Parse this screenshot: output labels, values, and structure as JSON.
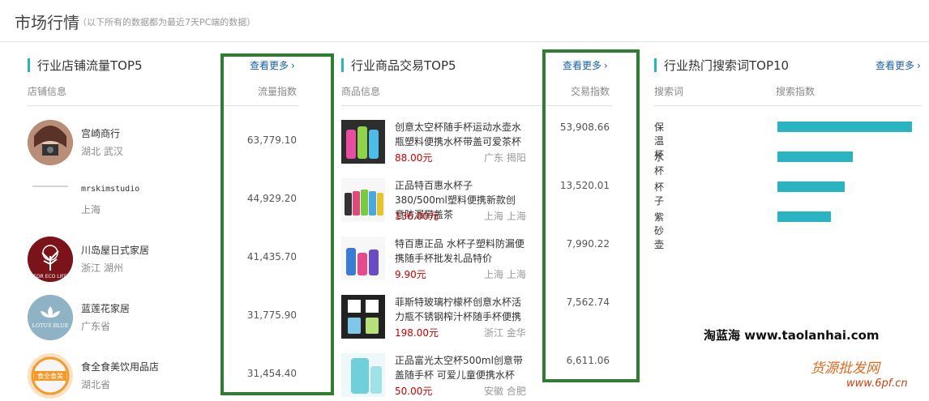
{
  "header": {
    "title": "市场行情",
    "subtitle": "（以下所有的数据都为最近7天PC端的数据）"
  },
  "shops": {
    "title": "行业店铺流量TOP5",
    "more": "查看更多",
    "col_info": "店铺信息",
    "col_value": "流量指数",
    "items": [
      {
        "name": "宫崎商行",
        "location": "湖北 武汉",
        "value": "63,779.10",
        "avatar_text": ""
      },
      {
        "name": "mrskimstudio",
        "location": "上海",
        "value": "44,929.20",
        "avatar_text": ""
      },
      {
        "name": "川岛屋日式家居",
        "location": "浙江 湖州",
        "value": "41,435.70",
        "avatar_text": "FOR ECO LIFE"
      },
      {
        "name": "蓝莲花家居",
        "location": "广东省",
        "value": "31,775.90",
        "avatar_text": "LOTUS BLUE"
      },
      {
        "name": "食全食美饮用品店",
        "location": "湖北省",
        "value": "31,454.40",
        "avatar_text": "食全食美"
      }
    ]
  },
  "products": {
    "title": "行业商品交易TOP5",
    "more": "查看更多",
    "col_info": "商品信息",
    "col_value": "交易指数",
    "items": [
      {
        "name": "创意太空杯随手杯运动水壶水瓶塑料便携水杯带盖可爱茶杯",
        "price": "88.00元",
        "location": "广东 揭阳",
        "value": "53,908.66"
      },
      {
        "name": "正品特百惠水杯子380/500ml塑料便携新款创意防漏带盖茶",
        "price": "136.00元",
        "location": "上海 上海",
        "value": "13,520.01"
      },
      {
        "name": "特百惠正品 水杯子塑料防漏便携随手杯批发礼品特价",
        "price": "9.90元",
        "location": "上海 上海",
        "value": "7,990.22"
      },
      {
        "name": "菲斯特玻璃柠檬杯创意水杯活力瓶不锈钢榨汁杯随手杯便携",
        "price": "198.00元",
        "location": "浙江 金华",
        "value": "7,562.74"
      },
      {
        "name": "正品富光太空杯500ml创意带盖随手杯 可爱儿童便携水杯",
        "price": "50.00元",
        "location": "安徽 合肥",
        "value": "6,611.06"
      }
    ]
  },
  "keywords": {
    "title": "行业热门搜索词TOP10",
    "more": "查看更多",
    "col_word": "搜索词",
    "col_index": "搜索指数",
    "items": [
      {
        "word": "保温杯",
        "level": 1.0
      },
      {
        "word": "水杯",
        "level": 0.56
      },
      {
        "word": "杯子",
        "level": 0.5
      },
      {
        "word": "紫砂壶",
        "level": 0.4
      }
    ],
    "bar_color": "#2ab3c1"
  },
  "watermarks": {
    "taolanhai": "淘蓝海 www.taolanhai.com",
    "huoyuan": "货源批发网",
    "url": "www.6pf.cn"
  },
  "colors": {
    "accent": "#2ab3c1",
    "link": "#1a5fa8",
    "price": "#cc0000",
    "highlight_box": "#2f7d32"
  }
}
